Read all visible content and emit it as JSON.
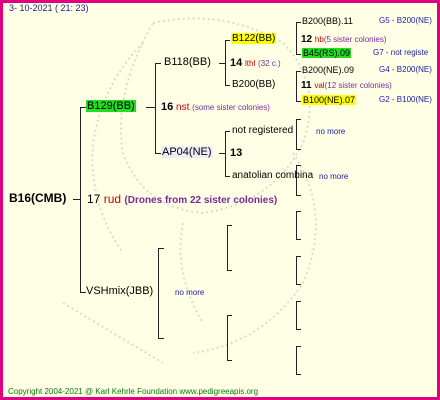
{
  "header": {
    "date": "3- 10-2021 ( 21: 23)"
  },
  "root": {
    "name": "B16(CMB)",
    "num": "17",
    "race": "rud",
    "note": "(Drones from 22 sister colonies)"
  },
  "mother": {
    "name": "B129(BB)",
    "num": "16",
    "race": "nst",
    "note": "(some sister colonies)"
  },
  "father": {
    "name": "VSHmix(JBB)",
    "note": "no more"
  },
  "gm": {
    "name": "B118(BB)",
    "num": "14",
    "race": "lthl",
    "note": "(32 c.)"
  },
  "gf": {
    "name": "AP04(NE)",
    "num": "13"
  },
  "ggm1": {
    "name": "B122(BB)",
    "num": "12",
    "race": "hb",
    "note": "(5 sister colonies)"
  },
  "ggf1": {
    "name": "B200(BB)",
    "num": "11",
    "race": "val",
    "note": "(12 sister colonies)"
  },
  "ggm2": {
    "name": "not registered",
    "note": "no more"
  },
  "ggf2": {
    "name": "anatolian combina",
    "note": "no more"
  },
  "g3": [
    {
      "name": "B200(BB).11",
      "ref": "G5 - B200(NE)"
    },
    {
      "name": "B45(RS).09",
      "ref": "G7 - not registe"
    },
    {
      "name": "B200(NE).09",
      "ref": "G4 - B200(NE)"
    },
    {
      "name": "B100(NE).07",
      "ref": "G2 - B100(NE)"
    }
  ],
  "footer": {
    "copyright": "Copyright 2004-2021 @ Karl Kehrle Foundation   www.pedigreeapis.org"
  },
  "colors": {
    "border": "#e0007f",
    "background": "#ffffe6",
    "highlight_green": "#22dd22",
    "highlight_yellow": "#ffff00",
    "link_blue": "#1a1aaa",
    "race_red": "#cc0000",
    "note_purple": "#7a2a9a",
    "footer_green": "#0a7a0a"
  }
}
